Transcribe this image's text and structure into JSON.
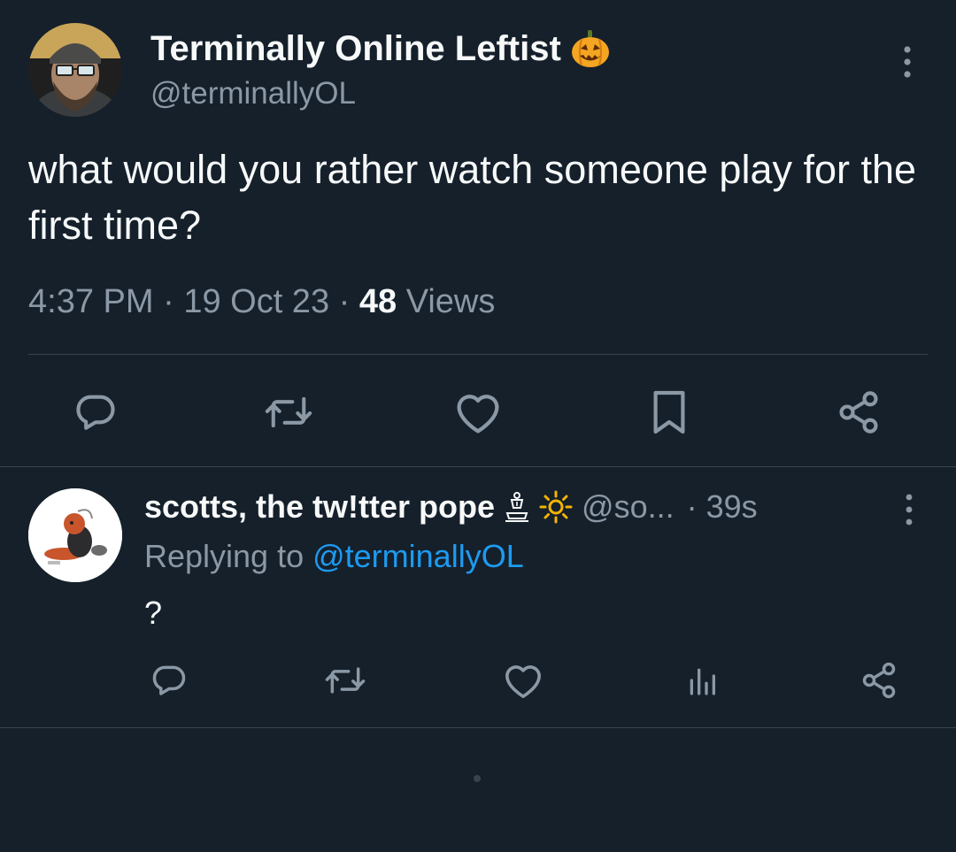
{
  "main_tweet": {
    "author": {
      "display_name": "Terminally Online Leftist",
      "badge_icon": "jack-o-lantern-emoji",
      "handle": "@terminallyOL"
    },
    "text": "what would you rather watch someone play for the first time?",
    "meta": {
      "time": "4:37 PM",
      "separator_1": " · ",
      "date": "19 Oct 23",
      "separator_2": " · ",
      "views_count": "48",
      "views_label": " Views"
    },
    "actions": [
      {
        "name": "reply",
        "icon": "speech-bubble-icon"
      },
      {
        "name": "retweet",
        "icon": "retweet-icon"
      },
      {
        "name": "like",
        "icon": "heart-icon"
      },
      {
        "name": "bookmark",
        "icon": "bookmark-icon"
      },
      {
        "name": "share",
        "icon": "share-icon"
      }
    ]
  },
  "reply_tweet": {
    "author": {
      "display_name": "scotts, the tw!tter pope",
      "badge_icons": [
        "pope-figure-emoji",
        "sun-emoji"
      ],
      "handle": "@so...",
      "time": "· 39s"
    },
    "replying_prefix": "Replying to ",
    "replying_to": "@terminallyOL",
    "text": "?",
    "actions": [
      {
        "name": "reply",
        "icon": "speech-bubble-icon"
      },
      {
        "name": "retweet",
        "icon": "retweet-icon"
      },
      {
        "name": "like",
        "icon": "heart-icon"
      },
      {
        "name": "views",
        "icon": "bar-chart-icon"
      },
      {
        "name": "share",
        "icon": "share-icon"
      }
    ]
  },
  "colors": {
    "background": "#15202b",
    "primary_text": "#f7f9f9",
    "secondary_text": "#8b98a5",
    "link": "#1d9bf0",
    "divider": "#38444d"
  }
}
